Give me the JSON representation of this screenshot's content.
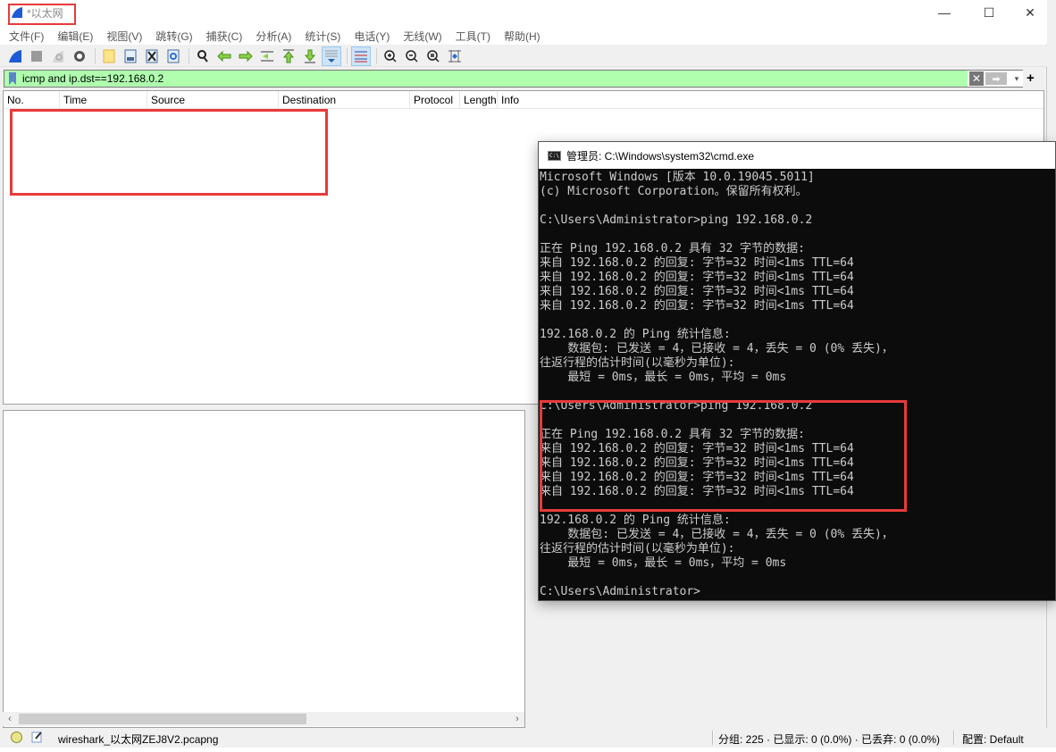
{
  "wireshark": {
    "title": "*以太网",
    "window_controls": {
      "minimize": "—",
      "maximize": "☐",
      "close": "✕"
    },
    "menu": [
      "文件(F)",
      "编辑(E)",
      "视图(V)",
      "跳转(G)",
      "捕获(C)",
      "分析(A)",
      "统计(S)",
      "电话(Y)",
      "无线(W)",
      "工具(T)",
      "帮助(H)"
    ],
    "toolbar_icons": [
      "start-capture-icon",
      "stop-capture-icon",
      "restart-capture-icon",
      "capture-options-icon",
      "open-file-icon",
      "save-file-icon",
      "close-file-icon",
      "reload-file-icon",
      "find-packet-icon",
      "go-back-icon",
      "go-forward-icon",
      "go-to-packet-icon",
      "go-first-icon",
      "go-last-icon",
      "autoscroll-icon",
      "colorize-icon",
      "zoom-in-icon",
      "zoom-out-icon",
      "zoom-normal-icon",
      "resize-columns-icon"
    ],
    "filter": {
      "value": "icmp and ip.dst==192.168.0.2",
      "clear_label": "✕",
      "apply_label": "➡",
      "dropdown_label": "▾",
      "add_label": "+"
    },
    "packet_list": {
      "columns": [
        "No.",
        "Time",
        "Source",
        "Destination",
        "Protocol",
        "Length",
        "Info"
      ],
      "rows": []
    },
    "status": {
      "file": "wireshark_以太网ZEJ8V2.pcapng",
      "stats": "分组: 225 · 已显示: 0 (0.0%) · 已丢弃: 0 (0.0%)",
      "profile": "配置: Default"
    }
  },
  "cmd": {
    "title": "管理员: C:\\Windows\\system32\\cmd.exe",
    "lines": [
      "Microsoft Windows [版本 10.0.19045.5011]",
      "(c) Microsoft Corporation。保留所有权利。",
      "",
      "C:\\Users\\Administrator>ping 192.168.0.2",
      "",
      "正在 Ping 192.168.0.2 具有 32 字节的数据:",
      "来自 192.168.0.2 的回复: 字节=32 时间<1ms TTL=64",
      "来自 192.168.0.2 的回复: 字节=32 时间<1ms TTL=64",
      "来自 192.168.0.2 的回复: 字节=32 时间<1ms TTL=64",
      "来自 192.168.0.2 的回复: 字节=32 时间<1ms TTL=64",
      "",
      "192.168.0.2 的 Ping 统计信息:",
      "    数据包: 已发送 = 4，已接收 = 4，丢失 = 0 (0% 丢失)，",
      "往返行程的估计时间(以毫秒为单位):",
      "    最短 = 0ms，最长 = 0ms，平均 = 0ms",
      "",
      "C:\\Users\\Administrator>ping 192.168.0.2",
      "",
      "正在 Ping 192.168.0.2 具有 32 字节的数据:",
      "来自 192.168.0.2 的回复: 字节=32 时间<1ms TTL=64",
      "来自 192.168.0.2 的回复: 字节=32 时间<1ms TTL=64",
      "来自 192.168.0.2 的回复: 字节=32 时间<1ms TTL=64",
      "来自 192.168.0.2 的回复: 字节=32 时间<1ms TTL=64",
      "",
      "192.168.0.2 的 Ping 统计信息:",
      "    数据包: 已发送 = 4，已接收 = 4，丢失 = 0 (0% 丢失)，",
      "往返行程的估计时间(以毫秒为单位):",
      "    最短 = 0ms，最长 = 0ms，平均 = 0ms",
      "",
      "C:\\Users\\Administrator>"
    ]
  },
  "annotations": {
    "highlight_color": "#e83a3a"
  }
}
